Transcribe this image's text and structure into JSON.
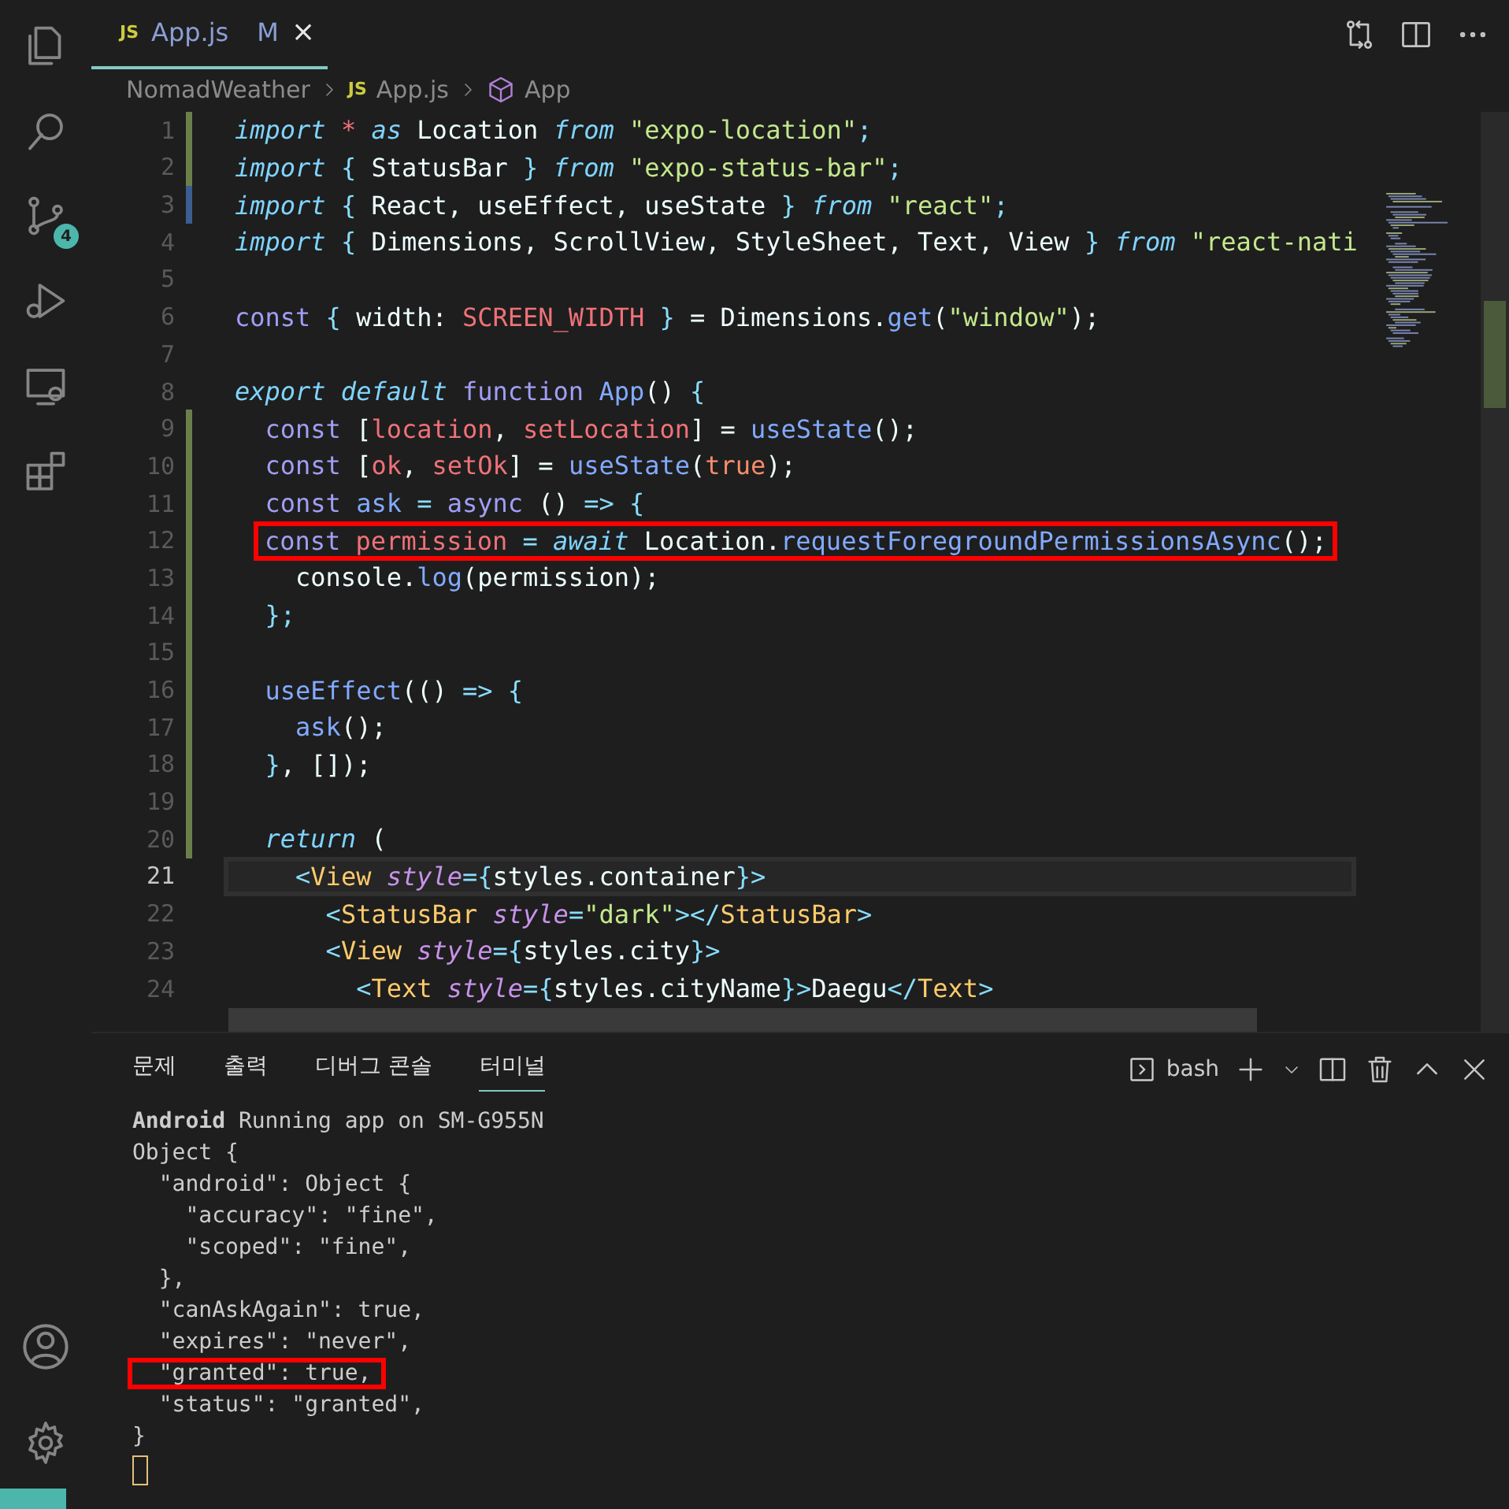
{
  "activity_bar": {
    "source_control_badge": "4"
  },
  "tabs": [
    {
      "icon_text": "JS",
      "label": "App.js",
      "status": "M",
      "close": "×",
      "selected": true
    }
  ],
  "breadcrumbs": [
    {
      "label": "NomadWeather"
    },
    {
      "icon_text": "JS",
      "label": "App.js"
    },
    {
      "label": "App"
    }
  ],
  "code": {
    "lines": [
      {
        "number": "1",
        "added": true,
        "modified": false,
        "current": false,
        "boxed": false,
        "tokens": [
          {
            "kind": "kw",
            "text": "import "
          },
          {
            "kind": "var",
            "text": "* "
          },
          {
            "kind": "kw",
            "text": "as "
          },
          {
            "kind": "plain",
            "text": "Location "
          },
          {
            "kind": "kw",
            "text": "from "
          },
          {
            "kind": "str",
            "text": "\"expo-location\""
          },
          {
            "kind": "punct",
            "text": ";"
          }
        ]
      },
      {
        "number": "2",
        "added": true,
        "modified": false,
        "current": false,
        "boxed": false,
        "tokens": [
          {
            "kind": "kw",
            "text": "import "
          },
          {
            "kind": "punct",
            "text": "{ "
          },
          {
            "kind": "plain",
            "text": "StatusBar "
          },
          {
            "kind": "punct",
            "text": "} "
          },
          {
            "kind": "kw",
            "text": "from "
          },
          {
            "kind": "str",
            "text": "\"expo-status-bar\""
          },
          {
            "kind": "punct",
            "text": ";"
          }
        ]
      },
      {
        "number": "3",
        "added": false,
        "modified": true,
        "current": false,
        "boxed": false,
        "tokens": [
          {
            "kind": "kw",
            "text": "import "
          },
          {
            "kind": "punct",
            "text": "{ "
          },
          {
            "kind": "plain",
            "text": "React, useEffect, useState "
          },
          {
            "kind": "punct",
            "text": "} "
          },
          {
            "kind": "kw",
            "text": "from "
          },
          {
            "kind": "str",
            "text": "\"react\""
          },
          {
            "kind": "punct",
            "text": ";"
          }
        ]
      },
      {
        "number": "4",
        "added": false,
        "modified": false,
        "current": false,
        "boxed": false,
        "tokens": [
          {
            "kind": "kw",
            "text": "import "
          },
          {
            "kind": "punct",
            "text": "{ "
          },
          {
            "kind": "plain",
            "text": "Dimensions, ScrollView, StyleSheet, Text, View "
          },
          {
            "kind": "punct",
            "text": "} "
          },
          {
            "kind": "kw",
            "text": "from "
          },
          {
            "kind": "str",
            "text": "\"react-nati"
          }
        ]
      },
      {
        "number": "5",
        "added": false,
        "modified": false,
        "current": false,
        "boxed": false
      },
      {
        "number": "6",
        "added": false,
        "modified": false,
        "current": false,
        "boxed": false,
        "tokens": [
          {
            "kind": "decl",
            "text": "const "
          },
          {
            "kind": "punct",
            "text": "{ "
          },
          {
            "kind": "plain",
            "text": "width: "
          },
          {
            "kind": "var",
            "text": "SCREEN_WIDTH "
          },
          {
            "kind": "punct",
            "text": "} "
          },
          {
            "kind": "plain",
            "text": "= Dimensions."
          },
          {
            "kind": "fn",
            "text": "get"
          },
          {
            "kind": "plain",
            "text": "("
          },
          {
            "kind": "str",
            "text": "\"window\""
          },
          {
            "kind": "plain",
            "text": ");"
          }
        ]
      },
      {
        "number": "7",
        "added": false,
        "modified": false,
        "current": false,
        "boxed": false
      },
      {
        "number": "8",
        "added": false,
        "modified": false,
        "current": false,
        "boxed": false,
        "tokens": [
          {
            "kind": "kw",
            "text": "export default "
          },
          {
            "kind": "decl",
            "text": "function "
          },
          {
            "kind": "fn",
            "text": "App"
          },
          {
            "kind": "plain",
            "text": "() "
          },
          {
            "kind": "punct",
            "text": "{"
          }
        ]
      },
      {
        "number": "9",
        "added": true,
        "modified": false,
        "current": false,
        "boxed": false,
        "tokens": [
          {
            "kind": "decl",
            "text": "  const "
          },
          {
            "kind": "plain",
            "text": "["
          },
          {
            "kind": "var",
            "text": "location"
          },
          {
            "kind": "plain",
            "text": ", "
          },
          {
            "kind": "var",
            "text": "setLocation"
          },
          {
            "kind": "plain",
            "text": "] = "
          },
          {
            "kind": "fn",
            "text": "useState"
          },
          {
            "kind": "plain",
            "text": "();"
          }
        ]
      },
      {
        "number": "10",
        "added": true,
        "modified": false,
        "current": false,
        "boxed": false,
        "tokens": [
          {
            "kind": "decl",
            "text": "  const "
          },
          {
            "kind": "plain",
            "text": "["
          },
          {
            "kind": "var",
            "text": "ok"
          },
          {
            "kind": "plain",
            "text": ", "
          },
          {
            "kind": "var",
            "text": "setOk"
          },
          {
            "kind": "plain",
            "text": "] = "
          },
          {
            "kind": "fn",
            "text": "useState"
          },
          {
            "kind": "plain",
            "text": "("
          },
          {
            "kind": "bool",
            "text": "true"
          },
          {
            "kind": "plain",
            "text": ");"
          }
        ]
      },
      {
        "number": "11",
        "added": true,
        "modified": false,
        "current": false,
        "boxed": false,
        "tokens": [
          {
            "kind": "decl",
            "text": "  const "
          },
          {
            "kind": "fn",
            "text": "ask "
          },
          {
            "kind": "op",
            "text": "= "
          },
          {
            "kind": "decl",
            "text": "async "
          },
          {
            "kind": "plain",
            "text": "() "
          },
          {
            "kind": "op",
            "text": "=> "
          },
          {
            "kind": "punct",
            "text": "{"
          }
        ]
      },
      {
        "number": "12",
        "added": true,
        "modified": false,
        "current": false,
        "boxed": true,
        "tokens": [
          {
            "kind": "decl",
            "text": "const "
          },
          {
            "kind": "var",
            "text": "permission "
          },
          {
            "kind": "op",
            "text": "= "
          },
          {
            "kind": "kw",
            "text": "await "
          },
          {
            "kind": "plain",
            "text": "Location."
          },
          {
            "kind": "fn",
            "text": "requestForegroundPermissionsAsync"
          },
          {
            "kind": "plain",
            "text": "();"
          }
        ]
      },
      {
        "number": "13",
        "added": true,
        "modified": false,
        "current": false,
        "boxed": false,
        "tokens": [
          {
            "kind": "plain",
            "text": "    console."
          },
          {
            "kind": "fn",
            "text": "log"
          },
          {
            "kind": "plain",
            "text": "(permission);"
          }
        ]
      },
      {
        "number": "14",
        "added": true,
        "modified": false,
        "current": false,
        "boxed": false,
        "tokens": [
          {
            "kind": "punct",
            "text": "  };"
          }
        ]
      },
      {
        "number": "15",
        "added": true,
        "modified": false,
        "current": false,
        "boxed": false
      },
      {
        "number": "16",
        "added": true,
        "modified": false,
        "current": false,
        "boxed": false,
        "tokens": [
          {
            "kind": "fn",
            "text": "  useEffect"
          },
          {
            "kind": "plain",
            "text": "(() "
          },
          {
            "kind": "op",
            "text": "=> "
          },
          {
            "kind": "punct",
            "text": "{"
          }
        ]
      },
      {
        "number": "17",
        "added": true,
        "modified": false,
        "current": false,
        "boxed": false,
        "tokens": [
          {
            "kind": "fn",
            "text": "    ask"
          },
          {
            "kind": "plain",
            "text": "();"
          }
        ]
      },
      {
        "number": "18",
        "added": true,
        "modified": false,
        "current": false,
        "boxed": false,
        "tokens": [
          {
            "kind": "punct",
            "text": "  }"
          },
          {
            "kind": "plain",
            "text": ", []);"
          }
        ]
      },
      {
        "number": "19",
        "added": true,
        "modified": false,
        "current": false,
        "boxed": false
      },
      {
        "number": "20",
        "added": true,
        "modified": false,
        "current": false,
        "boxed": false,
        "tokens": [
          {
            "kind": "kw",
            "text": "  return "
          },
          {
            "kind": "plain",
            "text": "("
          }
        ]
      },
      {
        "number": "21",
        "added": false,
        "modified": false,
        "current": true,
        "boxed": false,
        "tokens": [
          {
            "kind": "punct",
            "text": "    <"
          },
          {
            "kind": "tag",
            "text": "View "
          },
          {
            "kind": "attr",
            "text": "style"
          },
          {
            "kind": "op",
            "text": "="
          },
          {
            "kind": "punct",
            "text": "{"
          },
          {
            "kind": "plain",
            "text": "styles.container"
          },
          {
            "kind": "punct",
            "text": "}>"
          }
        ]
      },
      {
        "number": "22",
        "added": false,
        "modified": false,
        "current": false,
        "boxed": false,
        "tokens": [
          {
            "kind": "punct",
            "text": "      <"
          },
          {
            "kind": "tag",
            "text": "StatusBar "
          },
          {
            "kind": "attr",
            "text": "style"
          },
          {
            "kind": "op",
            "text": "="
          },
          {
            "kind": "str",
            "text": "\"dark\""
          },
          {
            "kind": "punct",
            "text": "></"
          },
          {
            "kind": "tag",
            "text": "StatusBar"
          },
          {
            "kind": "punct",
            "text": ">"
          }
        ]
      },
      {
        "number": "23",
        "added": false,
        "modified": false,
        "current": false,
        "boxed": false,
        "tokens": [
          {
            "kind": "punct",
            "text": "      <"
          },
          {
            "kind": "tag",
            "text": "View "
          },
          {
            "kind": "attr",
            "text": "style"
          },
          {
            "kind": "op",
            "text": "="
          },
          {
            "kind": "punct",
            "text": "{"
          },
          {
            "kind": "plain",
            "text": "styles.city"
          },
          {
            "kind": "punct",
            "text": "}>"
          }
        ]
      },
      {
        "number": "24",
        "added": false,
        "modified": false,
        "current": false,
        "boxed": false,
        "tokens": [
          {
            "kind": "punct",
            "text": "        <"
          },
          {
            "kind": "tag",
            "text": "Text "
          },
          {
            "kind": "attr",
            "text": "style"
          },
          {
            "kind": "op",
            "text": "="
          },
          {
            "kind": "punct",
            "text": "{"
          },
          {
            "kind": "plain",
            "text": "styles.cityName"
          },
          {
            "kind": "punct",
            "text": "}>"
          },
          {
            "kind": "plain",
            "text": "Daegu"
          },
          {
            "kind": "punct",
            "text": "</"
          },
          {
            "kind": "tag",
            "text": "Text"
          },
          {
            "kind": "punct",
            "text": ">"
          }
        ]
      }
    ]
  },
  "panel": {
    "tabs": [
      {
        "label": "문제",
        "selected": false
      },
      {
        "label": "출력",
        "selected": false
      },
      {
        "label": "디버그 콘솔",
        "selected": false
      },
      {
        "label": "터미널",
        "selected": true
      }
    ],
    "terminal_name": "bash",
    "terminal_lines": [
      {
        "text": "**Android** Running app on SM-G955N",
        "boxed": false
      },
      {
        "text": "Object {",
        "boxed": false
      },
      {
        "text": "  \"android\": Object {",
        "boxed": false
      },
      {
        "text": "    \"accuracy\": \"fine\",",
        "boxed": false
      },
      {
        "text": "    \"scoped\": \"fine\",",
        "boxed": false
      },
      {
        "text": "  },",
        "boxed": false
      },
      {
        "text": "  \"canAskAgain\": true,",
        "boxed": false
      },
      {
        "text": "  \"expires\": \"never\",",
        "boxed": false
      },
      {
        "text": "  \"granted\": true,",
        "boxed": true
      },
      {
        "text": "  \"status\": \"granted\",",
        "boxed": false
      },
      {
        "text": "}",
        "boxed": false
      }
    ]
  }
}
